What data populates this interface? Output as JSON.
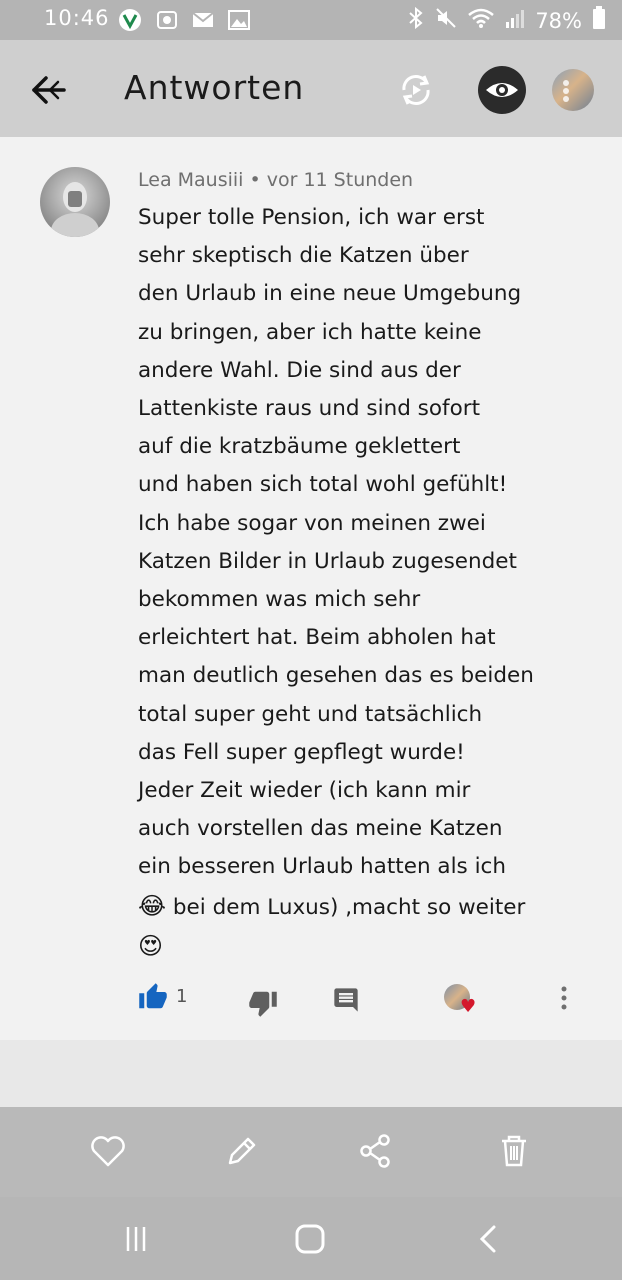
{
  "status_bar": {
    "time": "10:46",
    "battery": "78%",
    "left_icons": [
      "vpn-icon",
      "photo-lock-icon",
      "mail-icon",
      "image-icon"
    ],
    "right_icons": [
      "bluetooth-icon",
      "mute-icon",
      "wifi-icon",
      "signal-icon",
      "battery-icon"
    ]
  },
  "app_bar": {
    "title": "Antworten"
  },
  "comment": {
    "author": "Lea Mausiii",
    "separator": "•",
    "time_ago": "vor 11 Stunden",
    "text_main": "Super tolle Pension, ich war erst\nsehr skeptisch die Katzen über\nden Urlaub in eine neue Umgebung\nzu bringen, aber ich hatte keine\nandere Wahl. Die sind aus der\nLattenkiste raus und sind sofort\nauf die kratzbäume geklettert\nund haben sich total wohl gefühlt!\nIch habe sogar von meinen zwei\nKatzen Bilder in Urlaub zugesendet\nbekommen was mich sehr\nerleichtert hat. Beim abholen hat\nman deutlich gesehen das es beiden\ntotal super geht und tatsächlich\ndas Fell super gepflegt wurde!\nJeder Zeit wieder (ich kann mir\nauch vorstellen das meine Katzen\nein besseren Urlaub hatten als ich",
    "emoji_laugh": "😂",
    "text_tail": " bei dem Luxus) ,macht so weiter",
    "emoji_love": "😍",
    "like_count": "1"
  },
  "colors": {
    "like_blue": "#1565c0",
    "heart_red": "#d4182c"
  }
}
